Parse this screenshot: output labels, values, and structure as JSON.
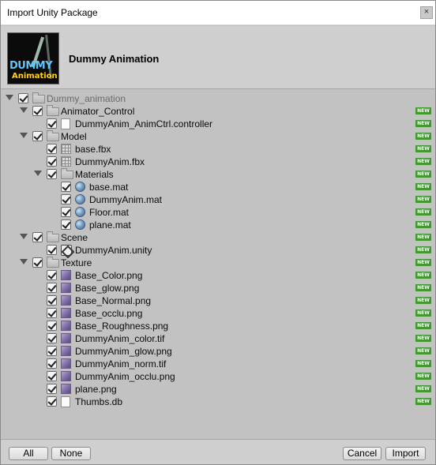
{
  "window": {
    "title": "Import Unity Package",
    "close_glyph": "×"
  },
  "package": {
    "name": "Dummy Animation",
    "thumb_line1": "DUMMY",
    "thumb_line2": "Animation"
  },
  "badge_label": "NEW",
  "tree": [
    {
      "label": "Dummy_animation",
      "icon": "folder-icon",
      "depth": 0,
      "arrow": true,
      "root": true,
      "new": false
    },
    {
      "label": "Animator_Control",
      "icon": "folder-icon",
      "depth": 1,
      "arrow": true,
      "new": true
    },
    {
      "label": "DummyAnim_AnimCtrl.controller",
      "icon": "file-icon",
      "depth": 2,
      "arrow": false,
      "new": true
    },
    {
      "label": "Model",
      "icon": "folder-icon",
      "depth": 1,
      "arrow": true,
      "new": true
    },
    {
      "label": "base.fbx",
      "icon": "mesh-icon",
      "depth": 2,
      "arrow": false,
      "new": true
    },
    {
      "label": "DummyAnim.fbx",
      "icon": "mesh-icon",
      "depth": 2,
      "arrow": false,
      "new": true
    },
    {
      "label": "Materials",
      "icon": "folder-icon",
      "depth": 2,
      "arrow": true,
      "new": true
    },
    {
      "label": "base.mat",
      "icon": "material-icon",
      "depth": 3,
      "arrow": false,
      "new": true
    },
    {
      "label": "DummyAnim.mat",
      "icon": "material-icon",
      "depth": 3,
      "arrow": false,
      "new": true
    },
    {
      "label": "Floor.mat",
      "icon": "material-icon",
      "depth": 3,
      "arrow": false,
      "new": true
    },
    {
      "label": "plane.mat",
      "icon": "material-icon",
      "depth": 3,
      "arrow": false,
      "new": true
    },
    {
      "label": "Scene",
      "icon": "folder-icon",
      "depth": 1,
      "arrow": true,
      "new": true
    },
    {
      "label": "DummyAnim.unity",
      "icon": "unity-scene-icon",
      "depth": 2,
      "arrow": false,
      "new": true
    },
    {
      "label": "Texture",
      "icon": "folder-icon",
      "depth": 1,
      "arrow": true,
      "new": true
    },
    {
      "label": "Base_Color.png",
      "icon": "texture-icon",
      "depth": 2,
      "arrow": false,
      "new": true
    },
    {
      "label": "Base_glow.png",
      "icon": "texture-icon",
      "depth": 2,
      "arrow": false,
      "new": true
    },
    {
      "label": "Base_Normal.png",
      "icon": "texture-icon",
      "depth": 2,
      "arrow": false,
      "new": true
    },
    {
      "label": "Base_occlu.png",
      "icon": "texture-icon",
      "depth": 2,
      "arrow": false,
      "new": true
    },
    {
      "label": "Base_Roughness.png",
      "icon": "texture-icon",
      "depth": 2,
      "arrow": false,
      "new": true
    },
    {
      "label": "DummyAnim_color.tif",
      "icon": "texture-icon",
      "depth": 2,
      "arrow": false,
      "new": true
    },
    {
      "label": "DummyAnim_glow.png",
      "icon": "texture-icon",
      "depth": 2,
      "arrow": false,
      "new": true
    },
    {
      "label": "DummyAnim_norm.tif",
      "icon": "texture-icon",
      "depth": 2,
      "arrow": false,
      "new": true
    },
    {
      "label": "DummyAnim_occlu.png",
      "icon": "texture-icon",
      "depth": 2,
      "arrow": false,
      "new": true
    },
    {
      "label": "plane.png",
      "icon": "texture-icon",
      "depth": 2,
      "arrow": false,
      "new": true
    },
    {
      "label": "Thumbs.db",
      "icon": "file-icon",
      "depth": 2,
      "arrow": false,
      "new": true
    }
  ],
  "footer": {
    "all_label": "All",
    "none_label": "None",
    "cancel_label": "Cancel",
    "import_label": "Import"
  },
  "colors": {
    "background": "#c2c2c2",
    "header": "#cfcfcf",
    "badge": "#3f9a2b"
  }
}
